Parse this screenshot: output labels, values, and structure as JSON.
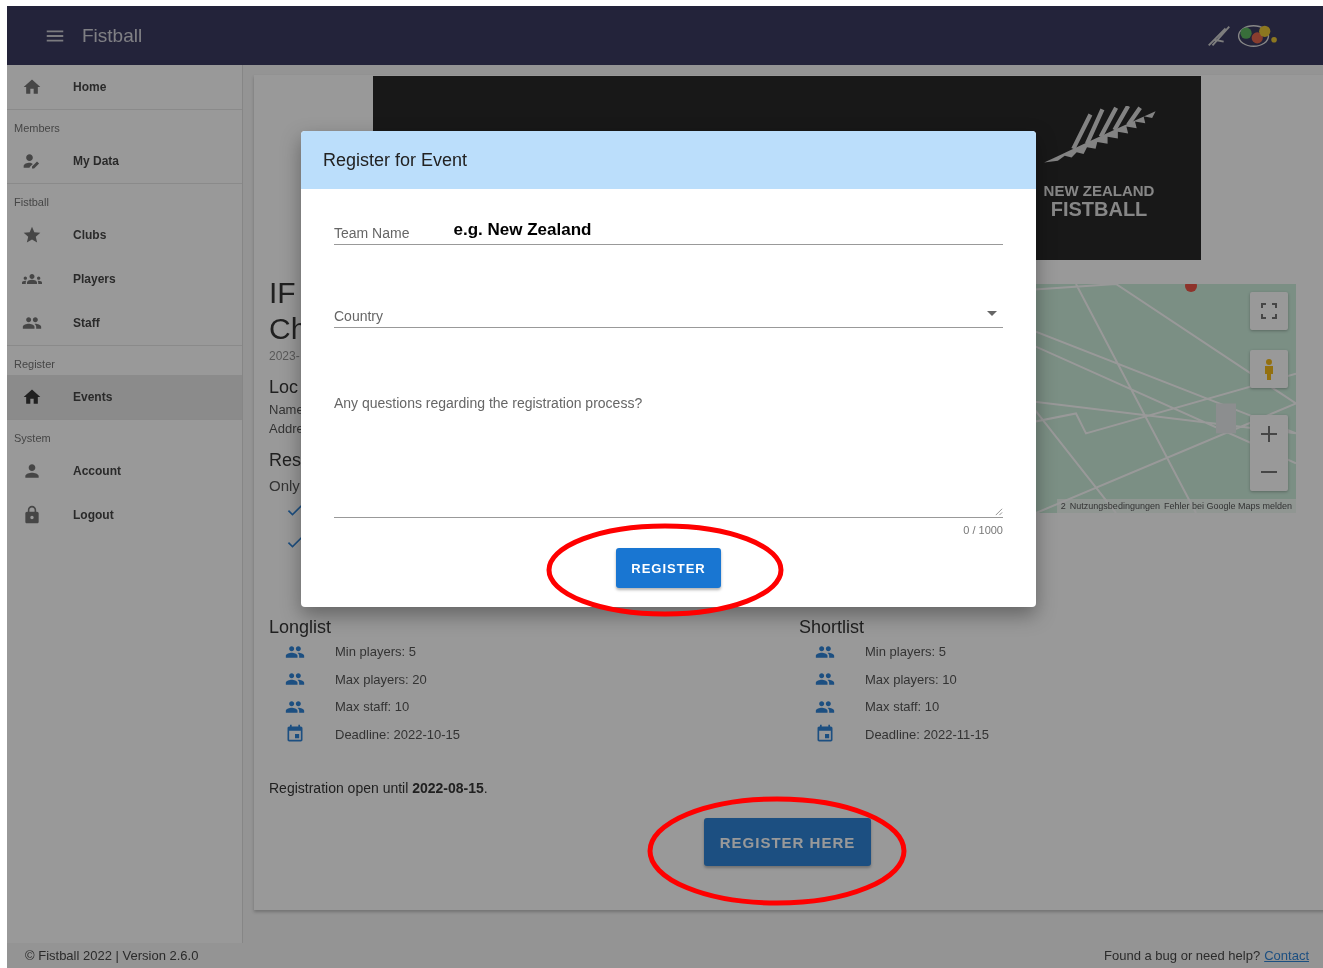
{
  "header": {
    "title": "Fistball"
  },
  "sidebar": {
    "sections": [
      {
        "items": [
          {
            "label": "Home",
            "selected": false
          }
        ]
      },
      {
        "subheader": "Members",
        "items": [
          {
            "label": "My Data",
            "selected": false
          }
        ]
      },
      {
        "subheader": "Fistball",
        "items": [
          {
            "label": "Clubs",
            "selected": false
          },
          {
            "label": "Players",
            "selected": false
          },
          {
            "label": "Staff",
            "selected": false
          }
        ]
      },
      {
        "subheader": "Register",
        "items": [
          {
            "label": "Events",
            "selected": true
          }
        ]
      },
      {
        "subheader": "System",
        "items": [
          {
            "label": "Account",
            "selected": false
          },
          {
            "label": "Logout",
            "selected": false
          }
        ]
      }
    ]
  },
  "event": {
    "banner": {
      "line_1": "NEW ZEALAND",
      "line_2": "FISTBALL"
    },
    "title_lines": [
      "IF",
      "Ch"
    ],
    "date": "2023-",
    "location": {
      "heading": "Loc",
      "lines": [
        "Name",
        "Addre"
      ]
    },
    "restrictions": {
      "heading": "Res",
      "text": "Only",
      "checks": [
        {
          "checked": true
        },
        {
          "checked": true
        }
      ]
    },
    "map": {
      "attribution": [
        "2",
        "Nutzungsbedingungen",
        "Fehler bei Google Maps melden"
      ]
    },
    "lists": [
      {
        "heading": "Longlist",
        "rows": [
          {
            "kind": "count",
            "text": "Min players: 5"
          },
          {
            "kind": "count",
            "text": "Max players: 20"
          },
          {
            "kind": "count",
            "text": "Max staff: 10"
          },
          {
            "kind": "deadline",
            "text": "Deadline: 2022-10-15"
          }
        ]
      },
      {
        "heading": "Shortlist",
        "rows": [
          {
            "kind": "count",
            "text": "Min players: 5"
          },
          {
            "kind": "count",
            "text": "Max players: 10"
          },
          {
            "kind": "count",
            "text": "Max staff: 10"
          },
          {
            "kind": "deadline",
            "text": "Deadline: 2022-11-15"
          }
        ]
      }
    ],
    "registration": "Registration open until **2022-08-15**.",
    "button": "REGISTER HERE"
  },
  "dialog": {
    "title": "Register for Event",
    "team_name": {
      "label": "Team Name",
      "value": "e.g. New Zealand"
    },
    "country": {
      "label": "Country"
    },
    "questions": {
      "label": "Any questions regarding the registration process?",
      "counter": "0 / 1000"
    },
    "button": "REGISTER"
  },
  "footer": {
    "copyright": "© Fistball 2022 | Version 2.6.0",
    "help": "Found a bug or need help?",
    "link": "Contact"
  }
}
